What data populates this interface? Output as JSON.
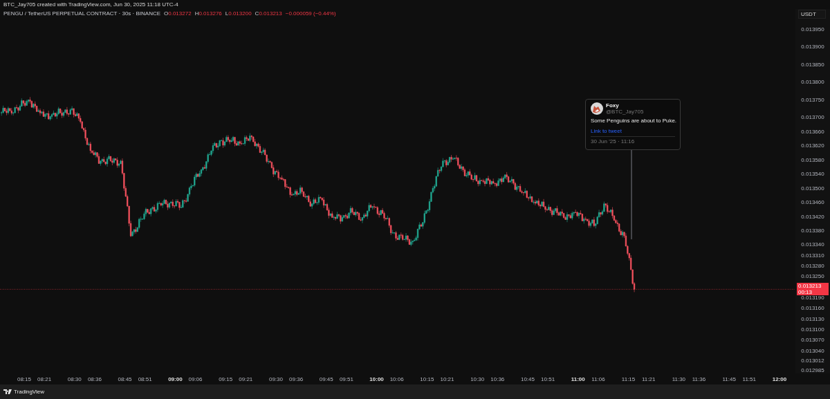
{
  "header": {
    "credit": "BTC_Jay705 created with TradingView.com, Jun 30, 2025 11:18 UTC-4"
  },
  "legend": {
    "symbol": "PENGU / TetherUS PERPETUAL CONTRACT · 30s · BINANCE",
    "ohlc": [
      {
        "label": "O",
        "value": "0.013272"
      },
      {
        "label": "H",
        "value": "0.013276"
      },
      {
        "label": "L",
        "value": "0.013200"
      },
      {
        "label": "C",
        "value": "0.013213"
      }
    ],
    "change": "−0.000059 (−0.44%)"
  },
  "price_axis": {
    "currency": "USDT",
    "ticks": [
      "0.013950",
      "0.013900",
      "0.013850",
      "0.013800",
      "0.013750",
      "0.013700",
      "0.013660",
      "0.013620",
      "0.013580",
      "0.013540",
      "0.013500",
      "0.013460",
      "0.013420",
      "0.013380",
      "0.013340",
      "0.013310",
      "0.013280",
      "0.013250",
      "0.013190",
      "0.013160",
      "0.013130",
      "0.013100",
      "0.013070",
      "0.013040",
      "0.013012",
      "0.012985"
    ]
  },
  "price_tag": {
    "price": "0.013213",
    "countdown": "00:13"
  },
  "tweet": {
    "name": "Foxy",
    "handle": "@BTC_Jay705",
    "text": "Some Penguins are about to Puke.",
    "link": "Link to tweet",
    "date": "30 Jun '25 · 11:16"
  },
  "time_axis": {
    "ticks": [
      "08:15",
      "08:21",
      "08:30",
      "08:36",
      "08:45",
      "08:51",
      "09:00",
      "09:06",
      "09:15",
      "09:21",
      "09:30",
      "09:36",
      "09:45",
      "09:51",
      "10:00",
      "10:06",
      "10:15",
      "10:21",
      "10:30",
      "10:36",
      "10:45",
      "10:51",
      "11:00",
      "11:06",
      "11:15",
      "11:21",
      "11:30",
      "11:36",
      "11:45",
      "11:51",
      "12:00"
    ]
  },
  "footer": {
    "brand": "TradingView"
  }
}
